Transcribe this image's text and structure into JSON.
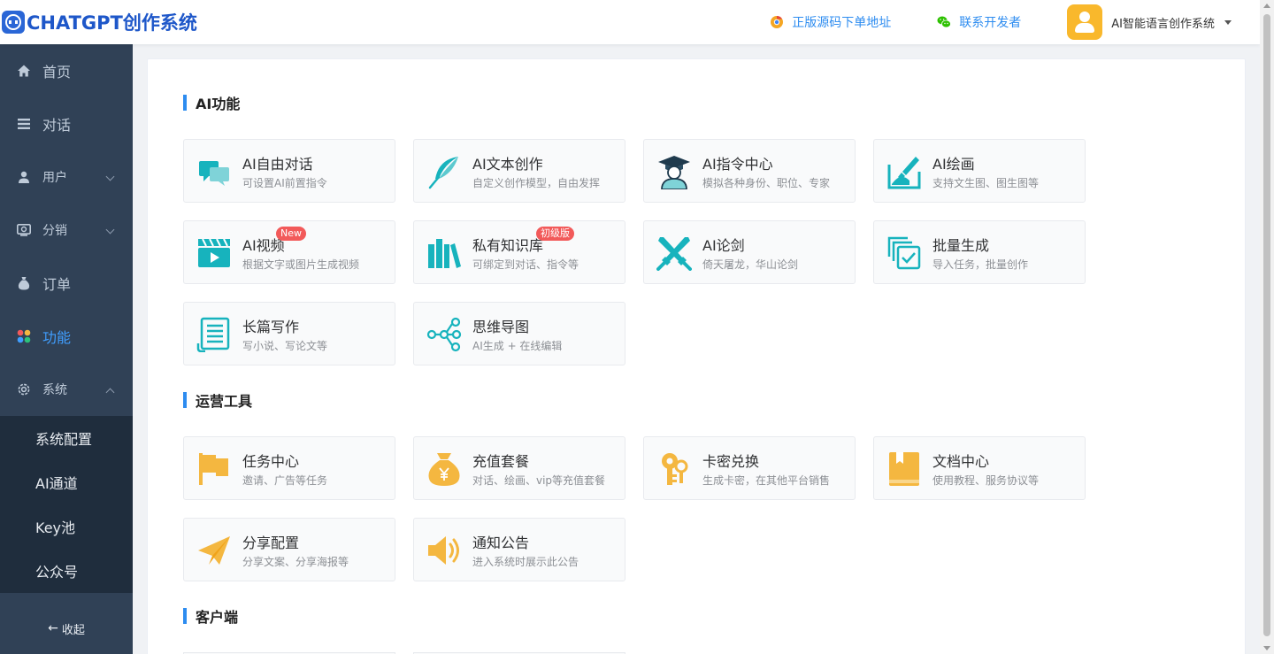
{
  "header": {
    "logo_text": "CHATGPT创作系统",
    "link_source": "正版源码下单地址",
    "link_contact": "联系开发者",
    "user_name": "AI智能语言创作系统"
  },
  "sidebar": {
    "items": [
      {
        "label": "首页",
        "icon": "home-icon"
      },
      {
        "label": "对话",
        "icon": "menu-icon"
      },
      {
        "label": "用户",
        "icon": "user-icon"
      },
      {
        "label": "分销",
        "icon": "distribution-icon"
      },
      {
        "label": "订单",
        "icon": "money-bag-icon"
      },
      {
        "label": "功能",
        "icon": "grid-icon"
      },
      {
        "label": "系统",
        "icon": "gear-icon"
      }
    ],
    "sub_items": [
      "系统配置",
      "AI通道",
      "Key池",
      "公众号"
    ],
    "collapse_label": "收起"
  },
  "sections": [
    {
      "title": "AI功能",
      "cards": [
        {
          "title": "AI自由对话",
          "desc": "可设置AI前置指令",
          "icon": "chat-bubbles-icon"
        },
        {
          "title": "AI文本创作",
          "desc": "自定义创作模型，自由发挥",
          "icon": "feather-icon"
        },
        {
          "title": "AI指令中心",
          "desc": "模拟各种身份、职位、专家",
          "icon": "graduate-icon"
        },
        {
          "title": "AI绘画",
          "desc": "支持文生图、图生图等",
          "icon": "painting-icon"
        },
        {
          "title": "AI视频",
          "desc": "根据文字或图片生成视频",
          "icon": "video-icon",
          "badge": "New"
        },
        {
          "title": "私有知识库",
          "desc": "可绑定到对话、指令等",
          "icon": "books-icon",
          "badge": "初级版"
        },
        {
          "title": "AI论剑",
          "desc": "倚天屠龙，华山论剑",
          "icon": "crossed-swords-icon"
        },
        {
          "title": "批量生成",
          "desc": "导入任务，批量创作",
          "icon": "batch-icon"
        },
        {
          "title": "长篇写作",
          "desc": "写小说、写论文等",
          "icon": "scroll-icon"
        },
        {
          "title": "思维导图",
          "desc": "AI生成 + 在线编辑",
          "icon": "mindmap-icon"
        }
      ]
    },
    {
      "title": "运营工具",
      "cards": [
        {
          "title": "任务中心",
          "desc": "邀请、广告等任务",
          "icon": "flag-icon"
        },
        {
          "title": "充值套餐",
          "desc": "对话、绘画、vip等充值套餐",
          "icon": "money-bag-icon"
        },
        {
          "title": "卡密兑换",
          "desc": "生成卡密，在其他平台销售",
          "icon": "key-icon"
        },
        {
          "title": "文档中心",
          "desc": "使用教程、服务协议等",
          "icon": "document-icon"
        },
        {
          "title": "分享配置",
          "desc": "分享文案、分享海报等",
          "icon": "paper-plane-icon"
        },
        {
          "title": "通知公告",
          "desc": "进入系统时展示此公告",
          "icon": "speaker-icon"
        }
      ]
    },
    {
      "title": "客户端",
      "cards": []
    }
  ],
  "colors": {
    "accent": "#2d8cf0",
    "teal": "#17b3bd",
    "orange": "#f4b740",
    "sidebar": "#304156"
  }
}
